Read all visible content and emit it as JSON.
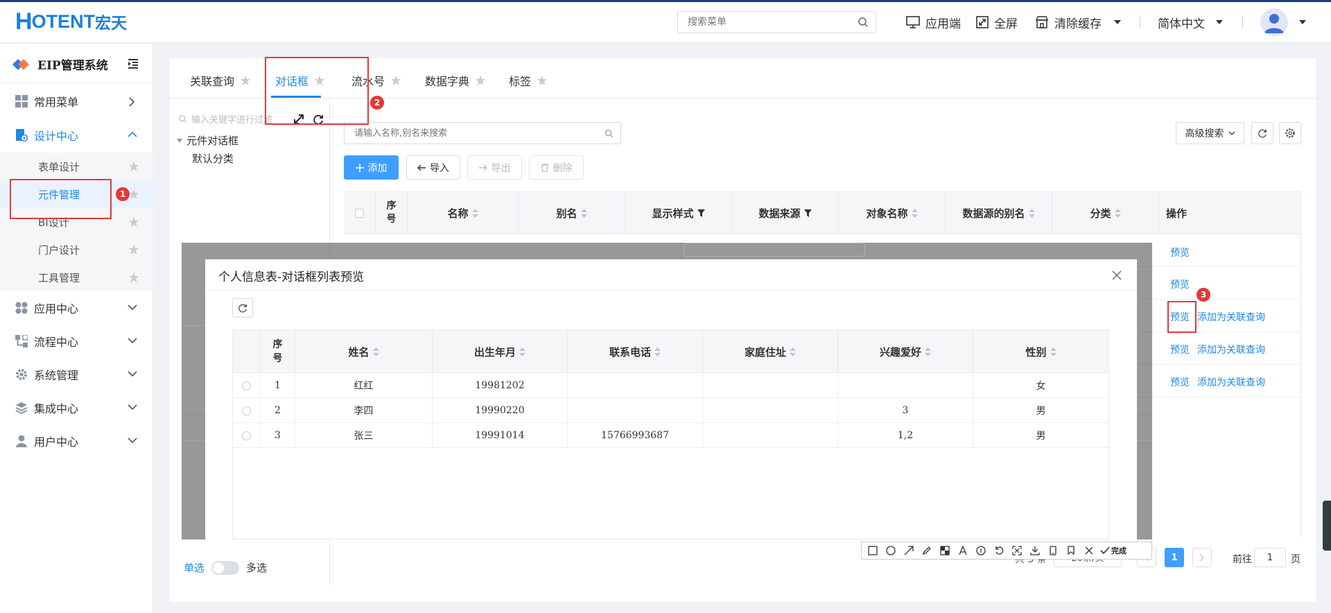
{
  "header": {
    "logo_h": "H",
    "logo_text": "OTENT",
    "logo_cn": "宏天",
    "search_placeholder": "搜索菜单",
    "app_btn": "应用端",
    "fullscreen_btn": "全屏",
    "clear_cache_btn": "清除缓存",
    "language": "简体中文"
  },
  "sidebar": {
    "title": "EIP管理系统",
    "items": [
      {
        "label": "常用菜单"
      },
      {
        "label": "设计中心"
      },
      {
        "label": "应用中心"
      },
      {
        "label": "流程中心"
      },
      {
        "label": "系统管理"
      },
      {
        "label": "集成中心"
      },
      {
        "label": "用户中心"
      }
    ],
    "sub_items": [
      {
        "label": "表单设计"
      },
      {
        "label": "元件管理"
      },
      {
        "label": "BI设计"
      },
      {
        "label": "门户设计"
      },
      {
        "label": "工具管理"
      }
    ]
  },
  "tabs": [
    {
      "label": "关联查询"
    },
    {
      "label": "对话框"
    },
    {
      "label": "流水号"
    },
    {
      "label": "数据字典"
    },
    {
      "label": "标签"
    }
  ],
  "tree": {
    "search_placeholder": "输入关键字进行过滤",
    "root": "元件对话框",
    "child": "默认分类"
  },
  "list": {
    "search_placeholder": "请输入名称,别名来搜索",
    "add_btn": "添加",
    "import_btn": "导入",
    "export_btn": "导出",
    "delete_btn": "删除",
    "adv_search": "高级搜索",
    "columns": {
      "seq": "序号",
      "name": "名称",
      "alias": "别名",
      "display_style": "显示样式",
      "data_source": "数据来源",
      "object_name": "对象名称",
      "source_alias": "数据源的别名",
      "category": "分类",
      "operation": "操作"
    },
    "preview_link": "预览",
    "add_related_link": "添加为关联查询",
    "pager": {
      "total_suffix": "共 5 条",
      "page_size": "20条/页",
      "current_page": "1",
      "goto_prefix": "前往",
      "goto_value": "1",
      "goto_suffix": "页"
    },
    "mode_single": "单选",
    "mode_multi": "多选"
  },
  "modal": {
    "title": "个人信息表-对话框列表预览",
    "columns": {
      "seq": "序号",
      "name": "姓名",
      "birth": "出生年月",
      "phone": "联系电话",
      "address": "家庭住址",
      "hobby": "兴趣爱好",
      "gender": "性别"
    },
    "rows": [
      {
        "seq": "1",
        "name": "红红",
        "birth": "19981202",
        "phone": "",
        "address": "",
        "hobby": "",
        "gender": "女"
      },
      {
        "seq": "2",
        "name": "李四",
        "birth": "19990220",
        "phone": "",
        "address": "",
        "hobby": "3",
        "gender": "男"
      },
      {
        "seq": "3",
        "name": "张三",
        "birth": "19991014",
        "phone": "15766993687",
        "address": "",
        "hobby": "1,2",
        "gender": "男"
      }
    ]
  },
  "annotations": {
    "badge1": "1",
    "badge2": "2",
    "badge3": "3",
    "toolbar_done": "完成"
  },
  "colors": {
    "primary": "#409eff",
    "link": "#1e88e5",
    "annotation": "#e53935",
    "logo": "#1e7fd8"
  }
}
